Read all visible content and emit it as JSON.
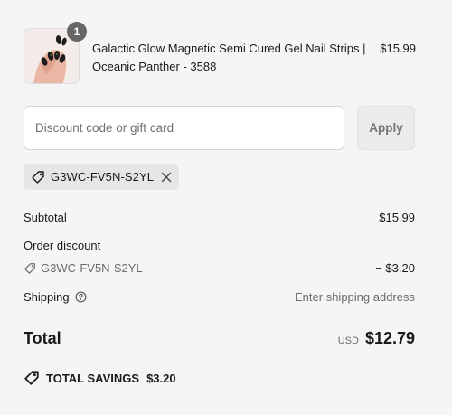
{
  "product": {
    "quantity": "1",
    "name": "Galactic Glow Magnetic Semi Cured Gel Nail Strips | Oceanic Panther - 3588",
    "price": "$15.99",
    "image_icon": "nail-product-image"
  },
  "discount": {
    "placeholder": "Discount code or gift card",
    "apply_label": "Apply",
    "applied_code": "G3WC-FV5N-S2YL"
  },
  "summary": {
    "subtotal_label": "Subtotal",
    "subtotal_value": "$15.99",
    "order_discount_label": "Order discount",
    "order_discount_code": "G3WC-FV5N-S2YL",
    "order_discount_value": "− $3.20",
    "shipping_label": "Shipping",
    "shipping_value": "Enter shipping address",
    "total_label": "Total",
    "currency": "USD",
    "total_value": "$12.79",
    "savings_label": "TOTAL SAVINGS",
    "savings_value": "$3.20"
  },
  "colors": {
    "background": "#f5f5f5",
    "badge": "#666666",
    "chip": "#e6e6e6"
  }
}
